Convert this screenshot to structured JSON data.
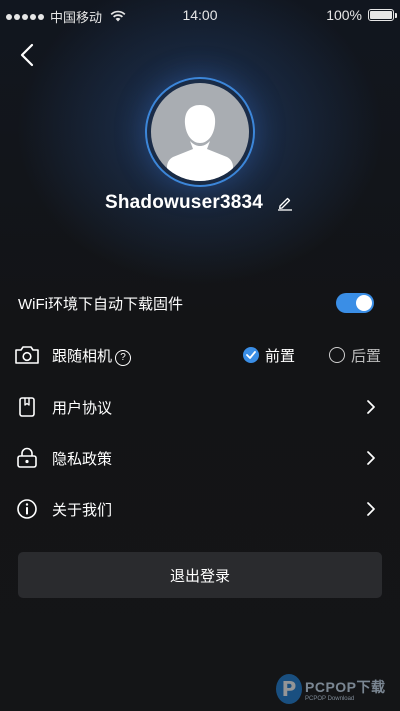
{
  "status_bar": {
    "carrier": "中国移动",
    "time": "14:00",
    "battery": "100%"
  },
  "profile": {
    "username": "Shadowuser3834"
  },
  "settings": {
    "wifi_firmware": {
      "label": "WiFi环境下自动下载固件",
      "enabled": true
    },
    "follow_camera": {
      "label": "跟随相机",
      "help": "?",
      "options": [
        {
          "label": "前置",
          "selected": true
        },
        {
          "label": "后置",
          "selected": false
        }
      ]
    },
    "menu": [
      {
        "label": "用户协议",
        "icon": "book-icon"
      },
      {
        "label": "隐私政策",
        "icon": "lock-icon"
      },
      {
        "label": "关于我们",
        "icon": "info-icon"
      }
    ]
  },
  "logout": {
    "label": "退出登录"
  },
  "watermark": {
    "letter": "P",
    "main": "PCPOP下载",
    "sub": "PCPOP Download"
  },
  "colors": {
    "accent": "#3a8ee6",
    "avatar_ring": "#3c86d9",
    "background": "#131416",
    "button_bg": "#2a2b2e"
  }
}
